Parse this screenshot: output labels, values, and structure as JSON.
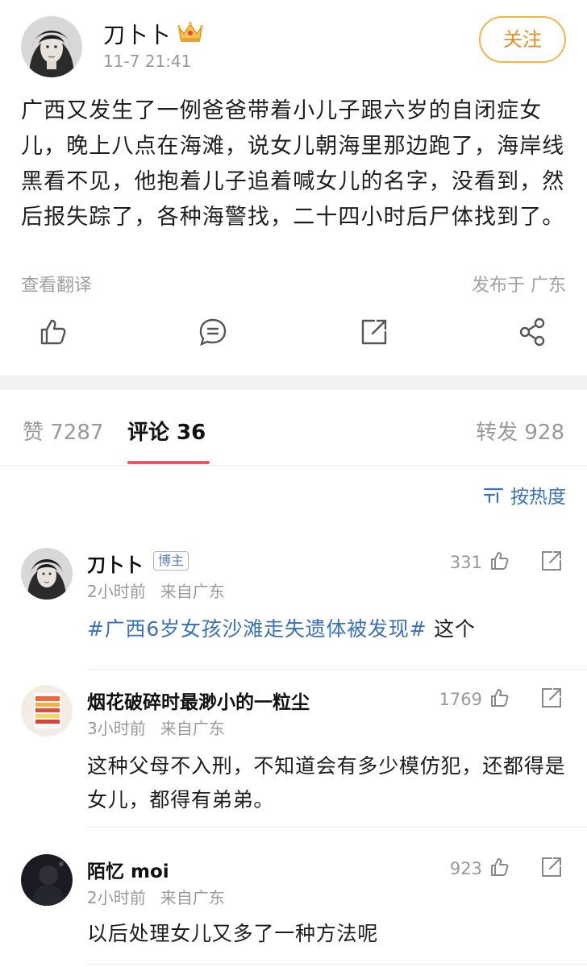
{
  "post": {
    "author": "刀卜卜",
    "time": "11-7 21:41",
    "follow_label": "关注",
    "text": "广西又发生了一例爸爸带着小儿子跟六岁的自闭症女儿，晚上八点在海滩，说女儿朝海里那边跑了，海岸线黑看不见，他抱着儿子追着喊女儿的名字，没看到，然后报失踪了，各种海警找，二十四小时后尸体找到了。",
    "translate_label": "查看翻译",
    "location": "发布于 广东"
  },
  "tabs": {
    "likes": "赞 7287",
    "comments": "评论 36",
    "reposts": "转发 928"
  },
  "sort": {
    "label": "按热度"
  },
  "comments": [
    {
      "name": "刀卜卜",
      "badge": "博主",
      "time": "2小时前",
      "from": "来自广东",
      "likes": "331",
      "hashtag": "#广西6岁女孩沙滩走失遗体被发现#",
      "text": " 这个"
    },
    {
      "name": "烟花破碎时最渺小的一粒尘",
      "time": "3小时前",
      "from": "来自广东",
      "likes": "1769",
      "text": "这种父母不入刑，不知道会有多少模仿犯，还都得是女儿，都得有弟弟。"
    },
    {
      "name": "陌忆 moi",
      "time": "2小时前",
      "from": "来自广东",
      "likes": "923",
      "text": "以后处理女儿又多了一种方法呢"
    }
  ],
  "colors": {
    "accent_orange": "#ec8a1c",
    "link_blue": "#3a72b8",
    "tab_underline": "#e8575d"
  }
}
